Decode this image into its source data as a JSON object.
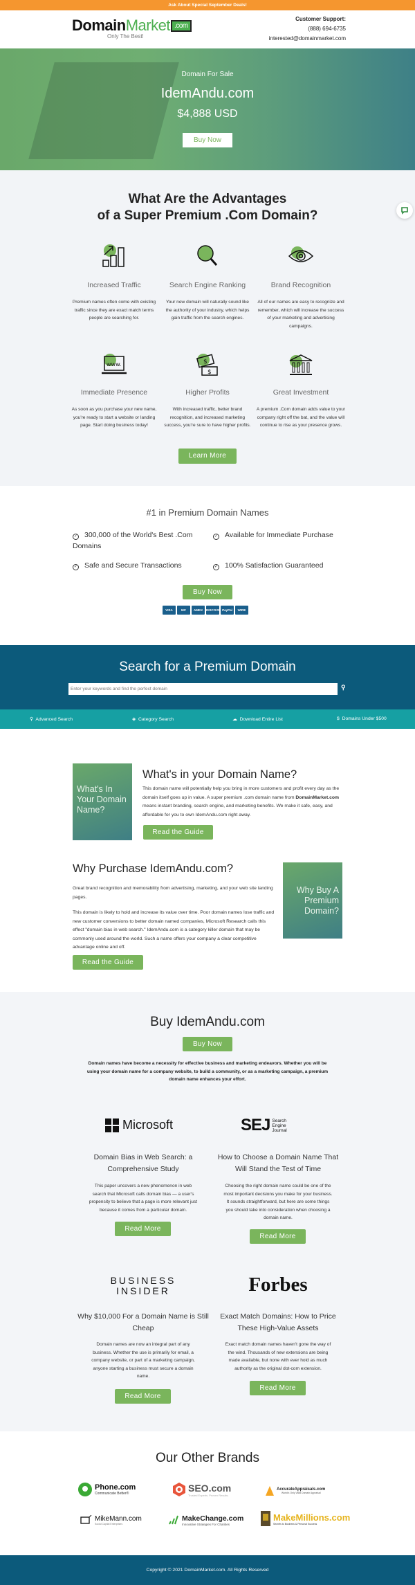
{
  "topbar": {
    "text": "Ask About Special September Deals!",
    "color": "#f5962f"
  },
  "header": {
    "logo_domain": "Domain",
    "logo_market": "Market",
    "logo_com": ".com",
    "logo_tagline": "Only The Best!",
    "support_label": "Customer Support:",
    "phone": "(888) 694-6735",
    "email": "interested@domainmarket.com"
  },
  "hero": {
    "eyebrow": "Domain For Sale",
    "domain": "IdemAndu.com",
    "price": "$4,888 USD",
    "buy_label": "Buy Now"
  },
  "advantages": {
    "title_line1": "What Are the Advantages",
    "title_line2": "of a Super Premium .Com Domain?",
    "items": [
      {
        "icon": "traffic-chart-icon",
        "title": "Increased Traffic",
        "desc": "Premium names often come with existing traffic since they are exact match terms people are searching for."
      },
      {
        "icon": "magnifier-icon",
        "title": "Search Engine Ranking",
        "desc": "Your new domain will naturally sound like the authority of your industry, which helps gain traffic from the search engines."
      },
      {
        "icon": "eye-icon",
        "title": "Brand Recognition",
        "desc": "All of our names are easy to recognize and remember, which will increase the success of your marketing and advertising campaigns."
      },
      {
        "icon": "www-laptop-icon",
        "title": "Immediate Presence",
        "desc": "As soon as you purchase your new name, you're ready to start a website or landing page. Start doing business today!"
      },
      {
        "icon": "money-icon",
        "title": "Higher Profits",
        "desc": "With increased traffic, better brand recognition, and increased marketing success, you're sure to have higher profits."
      },
      {
        "icon": "bank-icon",
        "title": "Great Investment",
        "desc": "A premium .Com domain adds value to your company right off the bat, and the value will continue to rise as your presence grows."
      }
    ],
    "learn_more_label": "Learn More"
  },
  "premium": {
    "title": "#1 in Premium Domain Names",
    "points": [
      "300,000 of the World's Best .Com Domains",
      "Available for Immediate Purchase",
      "Safe and Secure Transactions",
      "100% Satisfaction Guaranteed"
    ],
    "buy_label": "Buy Now",
    "payments": [
      "VISA",
      "MC",
      "AMEX",
      "DISCOVER",
      "PayPal",
      "WIRE"
    ]
  },
  "search": {
    "title": "Search for a Premium Domain",
    "placeholder": "Enter your keywords and find the perfect domain",
    "links": [
      {
        "icon": "search-icon",
        "label": "Advanced Search"
      },
      {
        "icon": "category-icon",
        "label": "Category Search"
      },
      {
        "icon": "cloud-download-icon",
        "label": "Download Entire List"
      },
      {
        "icon": "dollar-icon",
        "label": "Domains Under $500"
      }
    ]
  },
  "guide1": {
    "book": "What's In Your Domain Name?",
    "title": "What's in your Domain Name?",
    "text_a": "This domain name will potentially help you bring in more customers and profit every day as the domain itself goes up in value. A super premium .com domain name from ",
    "text_bold": "DomainMarket.com",
    "text_b": " means instant branding, search engine, and marketing benefits. We make it safe, easy, and affordable for you to own IdemAndu.com right away.",
    "button": "Read the Guide"
  },
  "guide2": {
    "book": "Why Buy A Premium Domain?",
    "title": "Why Purchase IdemAndu.com?",
    "para1": "Great brand recognition and memorability from advertising, marketing, and your web site landing pages.",
    "para2": "This domain is likely to hold and increase its value over time. Poor domain names lose traffic and new customer conversions to better domain named companies, Microsoft Research calls this effect \"domain bias in web search.\" IdemAndu.com is a category killer domain that may be commonly used around the world. Such a name offers your company a clear competitive advantage online and off.",
    "button": "Read the Guide"
  },
  "buy": {
    "title": "Buy IdemAndu.com",
    "buy_label": "Buy Now",
    "text": "Domain names have become a necessity for effective business and marketing endeavors. Whether you will be using your domain name for a company website, to build a community, or as a marketing campaign, a premium domain name enhances your effort.",
    "articles": [
      {
        "logo": "Microsoft",
        "title": "Domain Bias in Web Search: a Comprehensive Study",
        "desc": "This paper uncovers a new phenomenon in web search that Microsoft calls domain bias — a user's propensity to believe that a page is more relevant just because it comes from a particular domain.",
        "button": "Read More"
      },
      {
        "logo": "SEJ",
        "logo_sub": "Search Engine Journal",
        "title": "How to Choose a Domain Name That Will Stand the Test of Time",
        "desc": "Choosing the right domain name could be one of the most important decisions you make for your business. It sounds straightforward, but here are some things you should take into consideration when choosing a domain name.",
        "button": "Read More"
      },
      {
        "logo": "BUSINESS INSIDER",
        "title": "Why $10,000 For a Domain Name is Still Cheap",
        "desc": "Domain names are now an integral part of any business. Whether the use is primarily for email, a company website, or part of a marketing campaign, anyone starting a business must secure a domain name.",
        "button": "Read More"
      },
      {
        "logo": "Forbes",
        "title": "Exact Match Domains: How to Price These High-Value Assets",
        "desc": "Exact match domain names haven't gone the way of the wind. Thousands of new extensions are being made available, but none with ever hold as much authority as the original dot-com extension.",
        "button": "Read More"
      }
    ]
  },
  "brands": {
    "title": "Our Other Brands",
    "items": [
      {
        "name": "Phone.com",
        "tagline": "Communicate Better®"
      },
      {
        "name": "SEO.com",
        "tagline": "Trusted Experts. Proven Results."
      },
      {
        "name": "AccurateAppraisals.com",
        "tagline": "World's Only Valid Domain Appraisal"
      },
      {
        "name": "MikeMann.com",
        "tagline": "Social Capital Enterprises"
      },
      {
        "name": "MakeChange.com",
        "tagline": "Innovative Strategies For Charities"
      },
      {
        "name": "MakeMillions.com",
        "tagline": "Secrets to Business & Personal Success"
      }
    ]
  },
  "footer": {
    "copyright": "Copyright © 2021 DomainMarket.com. All Rights Reserved"
  },
  "colors": {
    "accent_green": "#7ab55c",
    "navy": "#0c5a7b",
    "teal": "#16a0a3",
    "orange": "#f5962f"
  }
}
